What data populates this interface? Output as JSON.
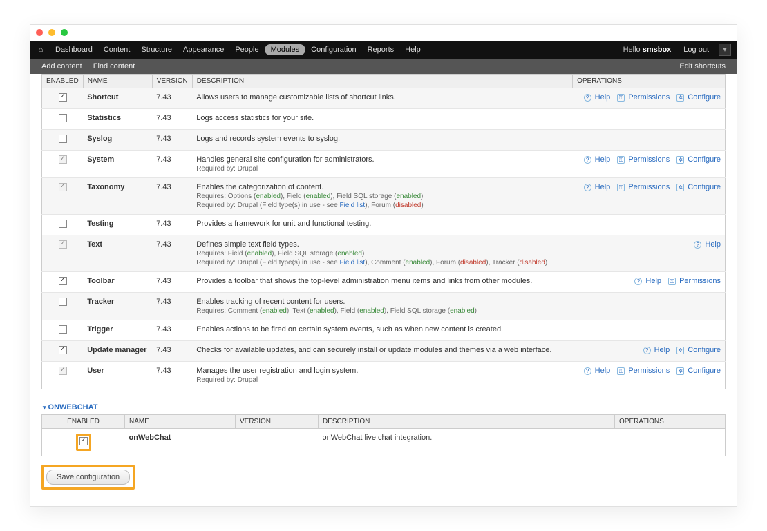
{
  "traffic": {},
  "toolbar": {
    "items": [
      {
        "label": "Dashboard"
      },
      {
        "label": "Content"
      },
      {
        "label": "Structure"
      },
      {
        "label": "Appearance"
      },
      {
        "label": "People"
      },
      {
        "label": "Modules",
        "active": true
      },
      {
        "label": "Configuration"
      },
      {
        "label": "Reports"
      },
      {
        "label": "Help"
      }
    ],
    "hello_prefix": "Hello ",
    "username": "smsbox",
    "logout": "Log out"
  },
  "subbar": {
    "add": "Add content",
    "find": "Find content",
    "edit": "Edit shortcuts"
  },
  "columns": {
    "enabled": "ENABLED",
    "name": "NAME",
    "version": "VERSION",
    "description": "DESCRIPTION",
    "operations": "OPERATIONS"
  },
  "modules": [
    {
      "checked": true,
      "locked": false,
      "name": "Shortcut",
      "version": "7.43",
      "desc": "Allows users to manage customizable lists of shortcut links.",
      "ops": [
        "help",
        "permissions",
        "configure"
      ]
    },
    {
      "checked": false,
      "locked": false,
      "name": "Statistics",
      "version": "7.43",
      "desc": "Logs access statistics for your site.",
      "ops": []
    },
    {
      "checked": false,
      "locked": false,
      "name": "Syslog",
      "version": "7.43",
      "desc": "Logs and records system events to syslog.",
      "ops": []
    },
    {
      "checked": true,
      "locked": true,
      "name": "System",
      "version": "7.43",
      "desc": "Handles general site configuration for administrators.",
      "sub1": "Required by: Drupal",
      "ops": [
        "help",
        "permissions",
        "configure"
      ]
    },
    {
      "checked": true,
      "locked": true,
      "name": "Taxonomy",
      "version": "7.43",
      "desc": "Enables the categorization of content.",
      "sub1": "Requires: Options (enabled), Field (enabled), Field SQL storage (enabled)",
      "sub2": "Required by: Drupal (Field type(s) in use - see Field list), Forum (disabled)",
      "ops": [
        "help",
        "permissions",
        "configure"
      ]
    },
    {
      "checked": false,
      "locked": false,
      "name": "Testing",
      "version": "7.43",
      "desc": "Provides a framework for unit and functional testing.",
      "ops": []
    },
    {
      "checked": true,
      "locked": true,
      "name": "Text",
      "version": "7.43",
      "desc": "Defines simple text field types.",
      "sub1": "Requires: Field (enabled), Field SQL storage (enabled)",
      "sub2": "Required by: Drupal (Field type(s) in use - see Field list), Comment (enabled), Forum (disabled), Tracker (disabled)",
      "ops": [
        "help"
      ]
    },
    {
      "checked": true,
      "locked": false,
      "name": "Toolbar",
      "version": "7.43",
      "desc": "Provides a toolbar that shows the top-level administration menu items and links from other modules.",
      "ops": [
        "help",
        "permissions"
      ]
    },
    {
      "checked": false,
      "locked": false,
      "name": "Tracker",
      "version": "7.43",
      "desc": "Enables tracking of recent content for users.",
      "sub1": "Requires: Comment (enabled), Text (enabled), Field (enabled), Field SQL storage (enabled)",
      "ops": []
    },
    {
      "checked": false,
      "locked": false,
      "name": "Trigger",
      "version": "7.43",
      "desc": "Enables actions to be fired on certain system events, such as when new content is created.",
      "ops": []
    },
    {
      "checked": true,
      "locked": false,
      "name": "Update manager",
      "version": "7.43",
      "desc": "Checks for available updates, and can securely install or update modules and themes via a web interface.",
      "ops": [
        "help",
        "configure"
      ]
    },
    {
      "checked": true,
      "locked": true,
      "name": "User",
      "version": "7.43",
      "desc": "Manages the user registration and login system.",
      "sub1": "Required by: Drupal",
      "ops": [
        "help",
        "permissions",
        "configure"
      ]
    }
  ],
  "op_labels": {
    "help": "Help",
    "permissions": "Permissions",
    "configure": "Configure"
  },
  "section2": {
    "title": "ONWEBCHAT",
    "row": {
      "checked": true,
      "name": "onWebChat",
      "version": "",
      "desc": "onWebChat live chat integration."
    }
  },
  "save_label": "Save configuration"
}
